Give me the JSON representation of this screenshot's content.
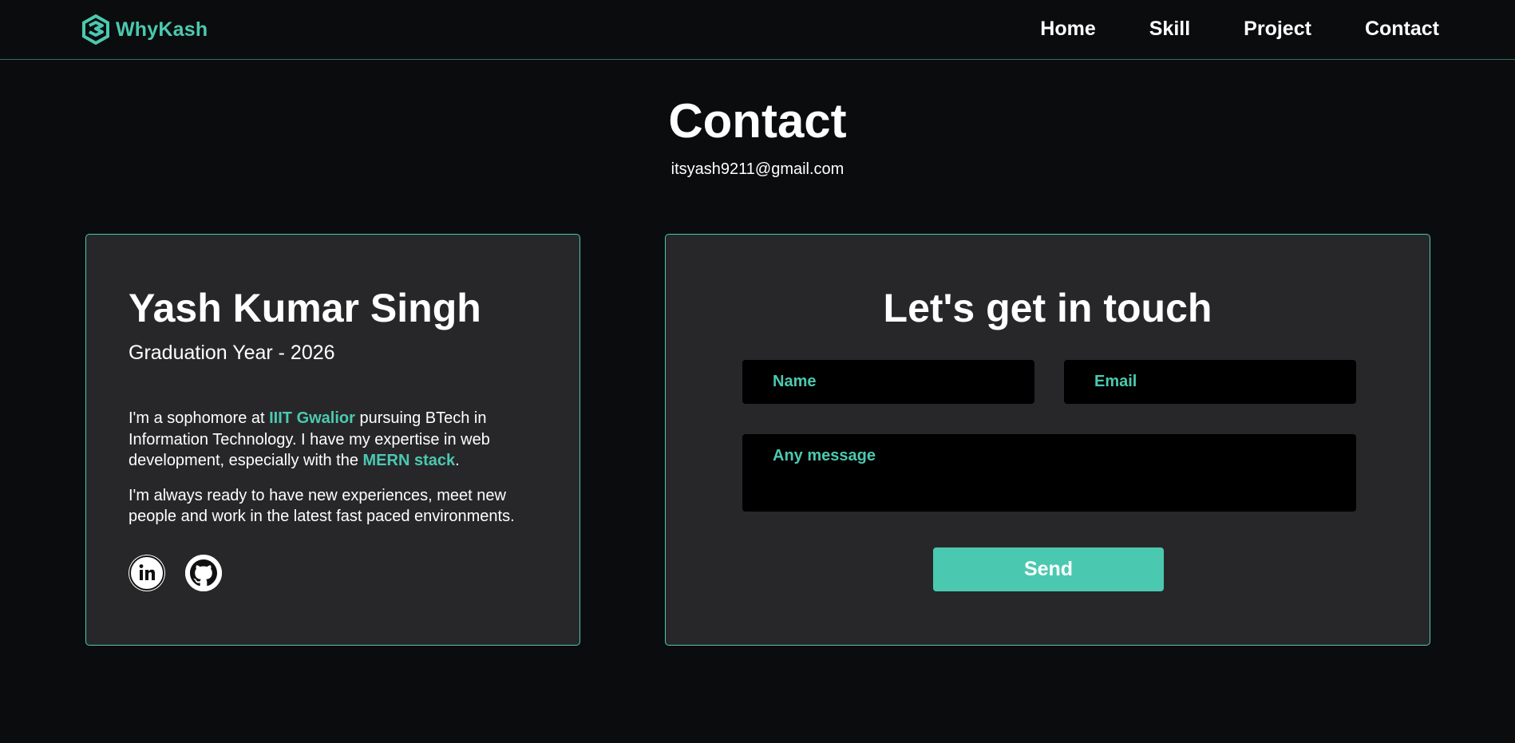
{
  "brand": {
    "name": "WhyKash",
    "logo_icon": "hexagon-logo-icon",
    "accent_color": "#4bc9b0"
  },
  "nav": {
    "items": [
      {
        "label": "Home"
      },
      {
        "label": "Skill"
      },
      {
        "label": "Project"
      },
      {
        "label": "Contact"
      }
    ]
  },
  "page": {
    "title": "Contact",
    "email": "itsyash9211@gmail.com"
  },
  "profile": {
    "name": "Yash Kumar Singh",
    "graduation": "Graduation Year - 2026",
    "bio1_part1": "I'm a sophomore at ",
    "bio1_highlight1": "IIIT Gwalior",
    "bio1_part2": " pursuing BTech in Information Technology. I have my expertise in web development, especially with the ",
    "bio1_highlight2": "MERN stack",
    "bio1_part3": ".",
    "bio2": "I'm always ready to have new experiences, meet new people and work in the latest fast paced environments.",
    "socials": [
      {
        "icon": "linkedin-icon"
      },
      {
        "icon": "github-icon"
      }
    ]
  },
  "form": {
    "title": "Let's get in touch",
    "name_placeholder": "Name",
    "email_placeholder": "Email",
    "message_placeholder": "Any message",
    "send_label": "Send"
  }
}
